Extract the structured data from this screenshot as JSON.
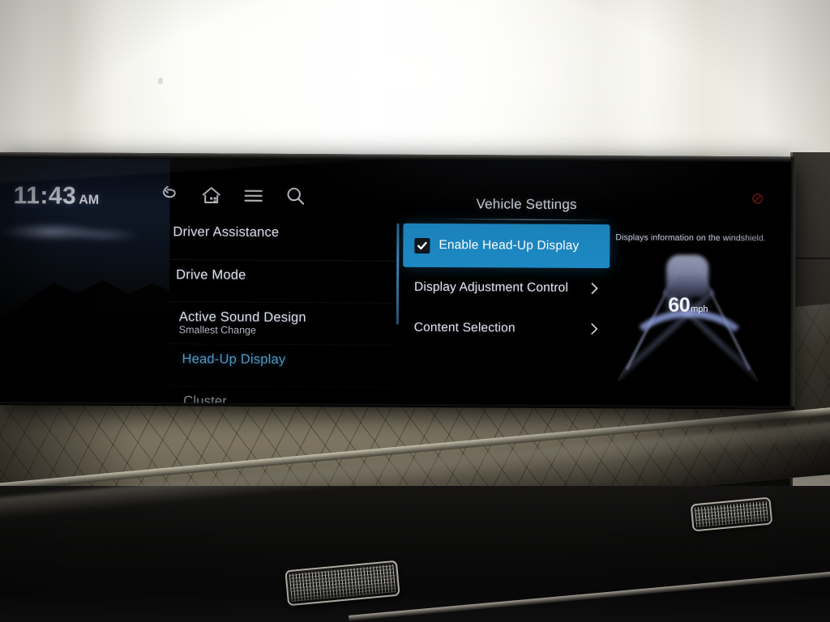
{
  "status_bar": {
    "time": "11:43",
    "meridiem": "AM",
    "icons": [
      {
        "name": "back-icon",
        "label": "Back"
      },
      {
        "name": "home-icon",
        "label": "Home"
      },
      {
        "name": "menu-icon",
        "label": "Menu"
      },
      {
        "name": "search-icon",
        "label": "Search"
      }
    ],
    "mute_icon": "mute-indicator-icon",
    "mute_color": "#b5201c"
  },
  "settings_menu": {
    "items": [
      {
        "label": "Driver Assistance",
        "sublabel": "",
        "selected": false
      },
      {
        "label": "Drive Mode",
        "sublabel": "",
        "selected": false
      },
      {
        "label": "Active Sound Design",
        "sublabel": "Smallest Change",
        "selected": false
      },
      {
        "label": "Head-Up Display",
        "sublabel": "",
        "selected": true
      },
      {
        "label": "Cluster",
        "sublabel": "",
        "selected": false
      }
    ]
  },
  "detail_pane": {
    "title": "Vehicle Settings",
    "options": [
      {
        "label": "Enable Head-Up Display",
        "type": "checkbox",
        "checked": true,
        "highlighted": true
      },
      {
        "label": "Display Adjustment Control",
        "type": "submenu",
        "checked": false,
        "highlighted": false
      },
      {
        "label": "Content Selection",
        "type": "submenu",
        "checked": false,
        "highlighted": false
      }
    ],
    "description": "Displays information on the windshield.",
    "preview": {
      "speed_value": "60",
      "speed_unit": "mph"
    }
  },
  "theme": {
    "accent_blue": "#1d88c2",
    "selected_text_blue": "#64b4e6",
    "text_primary": "#e4e7f1",
    "screen_black": "#000000",
    "dash_leather": "#968c76"
  }
}
